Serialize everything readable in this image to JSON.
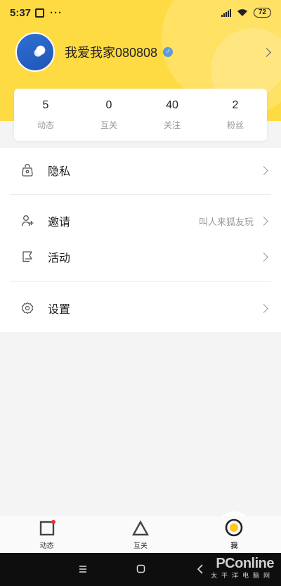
{
  "status_bar": {
    "time": "5:37",
    "dots": "···",
    "battery": "72"
  },
  "profile": {
    "username": "我爱我家080808",
    "gender_symbol": "♂"
  },
  "stats": [
    {
      "value": "5",
      "label": "动态"
    },
    {
      "value": "0",
      "label": "互关"
    },
    {
      "value": "40",
      "label": "关注"
    },
    {
      "value": "2",
      "label": "粉丝"
    }
  ],
  "menu": {
    "privacy": {
      "label": "隐私"
    },
    "invite": {
      "label": "邀请",
      "hint": "叫人来狐友玩"
    },
    "activity": {
      "label": "活动"
    },
    "settings": {
      "label": "设置"
    }
  },
  "bottom_nav": [
    {
      "label": "动态"
    },
    {
      "label": "互关"
    },
    {
      "label": "我"
    }
  ],
  "colors": {
    "brand_yellow": "#ffdb43",
    "notification_dot": "#e8322e"
  },
  "watermark": {
    "brand": "PConline",
    "subtitle": "太平洋电脑网"
  }
}
